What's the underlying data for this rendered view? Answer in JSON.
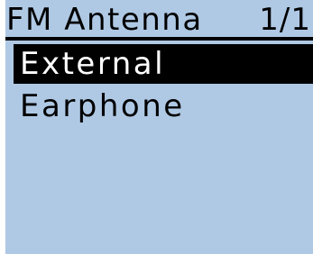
{
  "header": {
    "title": "FM Antenna",
    "page": "1/1"
  },
  "menu": {
    "items": [
      {
        "label": "External",
        "selected": true
      },
      {
        "label": "Earphone",
        "selected": false
      }
    ]
  },
  "colors": {
    "screen_background": "#afc8e4",
    "selection_background": "#000000",
    "selection_text": "#ffffff",
    "text": "#000000"
  }
}
